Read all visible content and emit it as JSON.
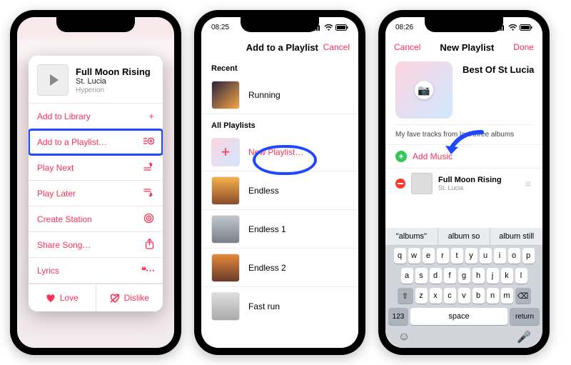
{
  "phone1": {
    "song": {
      "title": "Full Moon Rising",
      "artist": "St. Lucia",
      "album": "Hyperion"
    },
    "menu": {
      "add_library": "Add to Library",
      "add_playlist": "Add to a Playlist…",
      "play_next": "Play Next",
      "play_later": "Play Later",
      "create_station": "Create Station",
      "share_song": "Share Song…",
      "lyrics": "Lyrics"
    },
    "actions": {
      "love": "Love",
      "dislike": "Dislike"
    }
  },
  "phone2": {
    "status_time": "08:25",
    "nav": {
      "title": "Add to a Playlist",
      "cancel": "Cancel"
    },
    "sections": {
      "recent": "Recent",
      "all": "All Playlists"
    },
    "recent": [
      {
        "name": "Running"
      }
    ],
    "all": [
      {
        "name": "New Playlist…",
        "is_new": true
      },
      {
        "name": "Endless"
      },
      {
        "name": "Endless 1"
      },
      {
        "name": "Endless 2"
      },
      {
        "name": "Fast run"
      }
    ]
  },
  "phone3": {
    "status_time": "08:26",
    "nav": {
      "title": "New Playlist",
      "cancel": "Cancel",
      "done": "Done"
    },
    "playlist_name": "Best Of St Lucia",
    "note": "My fave tracks from last three albums",
    "add_music": "Add Music",
    "track": {
      "title": "Full Moon Rising",
      "artist": "St. Lucia"
    },
    "suggestions": [
      "\"albums\"",
      "album so",
      "album still"
    ],
    "keys": {
      "r1": [
        "q",
        "w",
        "e",
        "r",
        "t",
        "y",
        "u",
        "i",
        "o",
        "p"
      ],
      "r2": [
        "a",
        "s",
        "d",
        "f",
        "g",
        "h",
        "j",
        "k",
        "l"
      ],
      "r3": [
        "z",
        "x",
        "c",
        "v",
        "b",
        "n",
        "m"
      ],
      "num": "123",
      "space": "space",
      "return": "return"
    }
  }
}
